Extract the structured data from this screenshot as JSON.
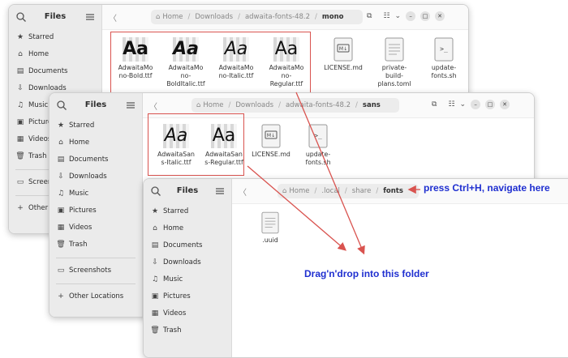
{
  "window_back": {
    "title": "Files",
    "path": [
      "Home",
      "Downloads",
      "adwaita-fonts-48.2",
      "mono"
    ],
    "sidebar": [
      "Starred",
      "Home",
      "Documents",
      "Downloads",
      "Music",
      "Pictures",
      "Videos",
      "Trash",
      "Screenshots",
      "Other Locations"
    ],
    "files": [
      {
        "name": "AdwaitaMono-Bold.ttf",
        "line1": "AdwaitaMo",
        "line2": "no-Bold.ttf",
        "line3": "",
        "glyph": "Aa"
      },
      {
        "name": "AdwaitaMono-BoldItalic.ttf",
        "line1": "AdwaitaMo",
        "line2": "no-",
        "line3": "BoldItalic.ttf",
        "glyph": "Aa"
      },
      {
        "name": "AdwaitaMono-Italic.ttf",
        "line1": "AdwaitaMo",
        "line2": "no-Italic.ttf",
        "line3": "",
        "glyph": "Aa"
      },
      {
        "name": "AdwaitaMono-Regular.ttf",
        "line1": "AdwaitaMo",
        "line2": "no-",
        "line3": "Regular.ttf",
        "glyph": "Aa"
      },
      {
        "name": "LICENSE.md",
        "line1": "LICENSE.md",
        "line2": "",
        "line3": ""
      },
      {
        "name": "private-build-plans.toml",
        "line1": "private-",
        "line2": "build-",
        "line3": "plans.toml"
      },
      {
        "name": "update-fonts.sh",
        "line1": "update-",
        "line2": "fonts.sh",
        "line3": ""
      }
    ]
  },
  "window_mid": {
    "title": "Files",
    "path": [
      "Home",
      "Downloads",
      "adwaita-fonts-48.2",
      "sans"
    ],
    "sidebar": [
      "Starred",
      "Home",
      "Documents",
      "Downloads",
      "Music",
      "Pictures",
      "Videos",
      "Trash",
      "Screenshots",
      "Other Locations"
    ],
    "files": [
      {
        "name": "AdwaitaSans-Italic.ttf",
        "line1": "AdwaitaSan",
        "line2": "s-Italic.ttf",
        "glyph": "Aa"
      },
      {
        "name": "AdwaitaSans-Regular.ttf",
        "line1": "AdwaitaSan",
        "line2": "s-Regular.ttf",
        "glyph": "Aa"
      },
      {
        "name": "LICENSE.md",
        "line1": "LICENSE.md",
        "line2": ""
      },
      {
        "name": "update-fonts.sh",
        "line1": "update-",
        "line2": "fonts.sh"
      }
    ]
  },
  "window_front": {
    "title": "Files",
    "path": [
      "Home",
      ".local",
      "share",
      "fonts"
    ],
    "sidebar": [
      "Starred",
      "Home",
      "Documents",
      "Downloads",
      "Music",
      "Pictures",
      "Videos",
      "Trash"
    ],
    "files": [
      {
        "name": ".uuid",
        "line1": ".uuid"
      }
    ]
  },
  "annotations": {
    "hint_top": "press Ctrl+H, navigate here",
    "hint_drop": "Drag'n'drop into this folder"
  },
  "colors": {
    "arrow": "#d9534f",
    "note": "#1f2fd0",
    "sidebar": "#ebebeb"
  }
}
